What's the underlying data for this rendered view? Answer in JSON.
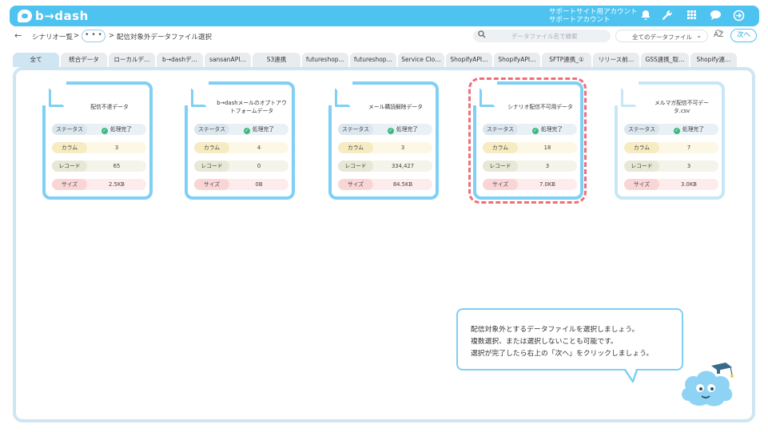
{
  "header": {
    "logo_text": "b→dash",
    "account_line1": "サポートサイト用アカウント",
    "account_line2": "サポートアカウント",
    "icons": [
      "bell-icon",
      "wrench-icon",
      "grid-icon",
      "chat-icon",
      "logout-icon"
    ]
  },
  "breadcrumb": {
    "back_icon": "←",
    "item1": "シナリオ一覧",
    "sep1": ">",
    "more": "• • •",
    "sep2": ">",
    "current": "配信対象外データファイル選択"
  },
  "toolbar": {
    "search_placeholder": "データファイル名で検索",
    "filter_value": "全てのデータファイル",
    "sort_label": "A͡Z",
    "next_label": "次へ"
  },
  "tabs": [
    {
      "label": "全て",
      "active": true
    },
    {
      "label": "統合データ"
    },
    {
      "label": "ローカルデ…"
    },
    {
      "label": "b→dashデ…"
    },
    {
      "label": "sansanAPI…"
    },
    {
      "label": "S3連携"
    },
    {
      "label": "futureshop…"
    },
    {
      "label": "futureshop…"
    },
    {
      "label": "Service Clo…"
    },
    {
      "label": "ShopifyAPI…"
    },
    {
      "label": "ShopifyAPI…"
    },
    {
      "label": "SFTP連携_①"
    },
    {
      "label": "リリース前…"
    },
    {
      "label": "GSS連携_取…"
    },
    {
      "label": "Shopify連…"
    }
  ],
  "row_labels": {
    "status": "ステータス",
    "column": "カラム",
    "record": "レコード",
    "size": "サイズ"
  },
  "cards": [
    {
      "title": "配信不達データ",
      "status": "処理完了",
      "column": "3",
      "record": "65",
      "size": "2.5KB"
    },
    {
      "title": "b→dashメールのオプトアウトフォームデータ",
      "status": "処理完了",
      "column": "4",
      "record": "0",
      "size": "0B"
    },
    {
      "title": "メール購読解除データ",
      "status": "処理完了",
      "column": "3",
      "record": "334,427",
      "size": "84.5KB"
    },
    {
      "title": "シナリオ配信不可用データ",
      "status": "処理完了",
      "column": "18",
      "record": "3",
      "size": "7.0KB"
    },
    {
      "title": "メルマガ配信不可データ.csv",
      "status": "処理完了",
      "column": "7",
      "record": "3",
      "size": "3.0KB"
    }
  ],
  "tooltip": {
    "line1": "配信対象外とするデータファイルを選択しましょう。",
    "line2": "複数選択、または選択しないことも可能です。",
    "line3": "選択が完了したら右上の「次へ」をクリックしましょう。"
  },
  "colors": {
    "brand": "#4fc3f0",
    "highlight": "#ee6f7b",
    "status_ok": "#3fb87f"
  }
}
